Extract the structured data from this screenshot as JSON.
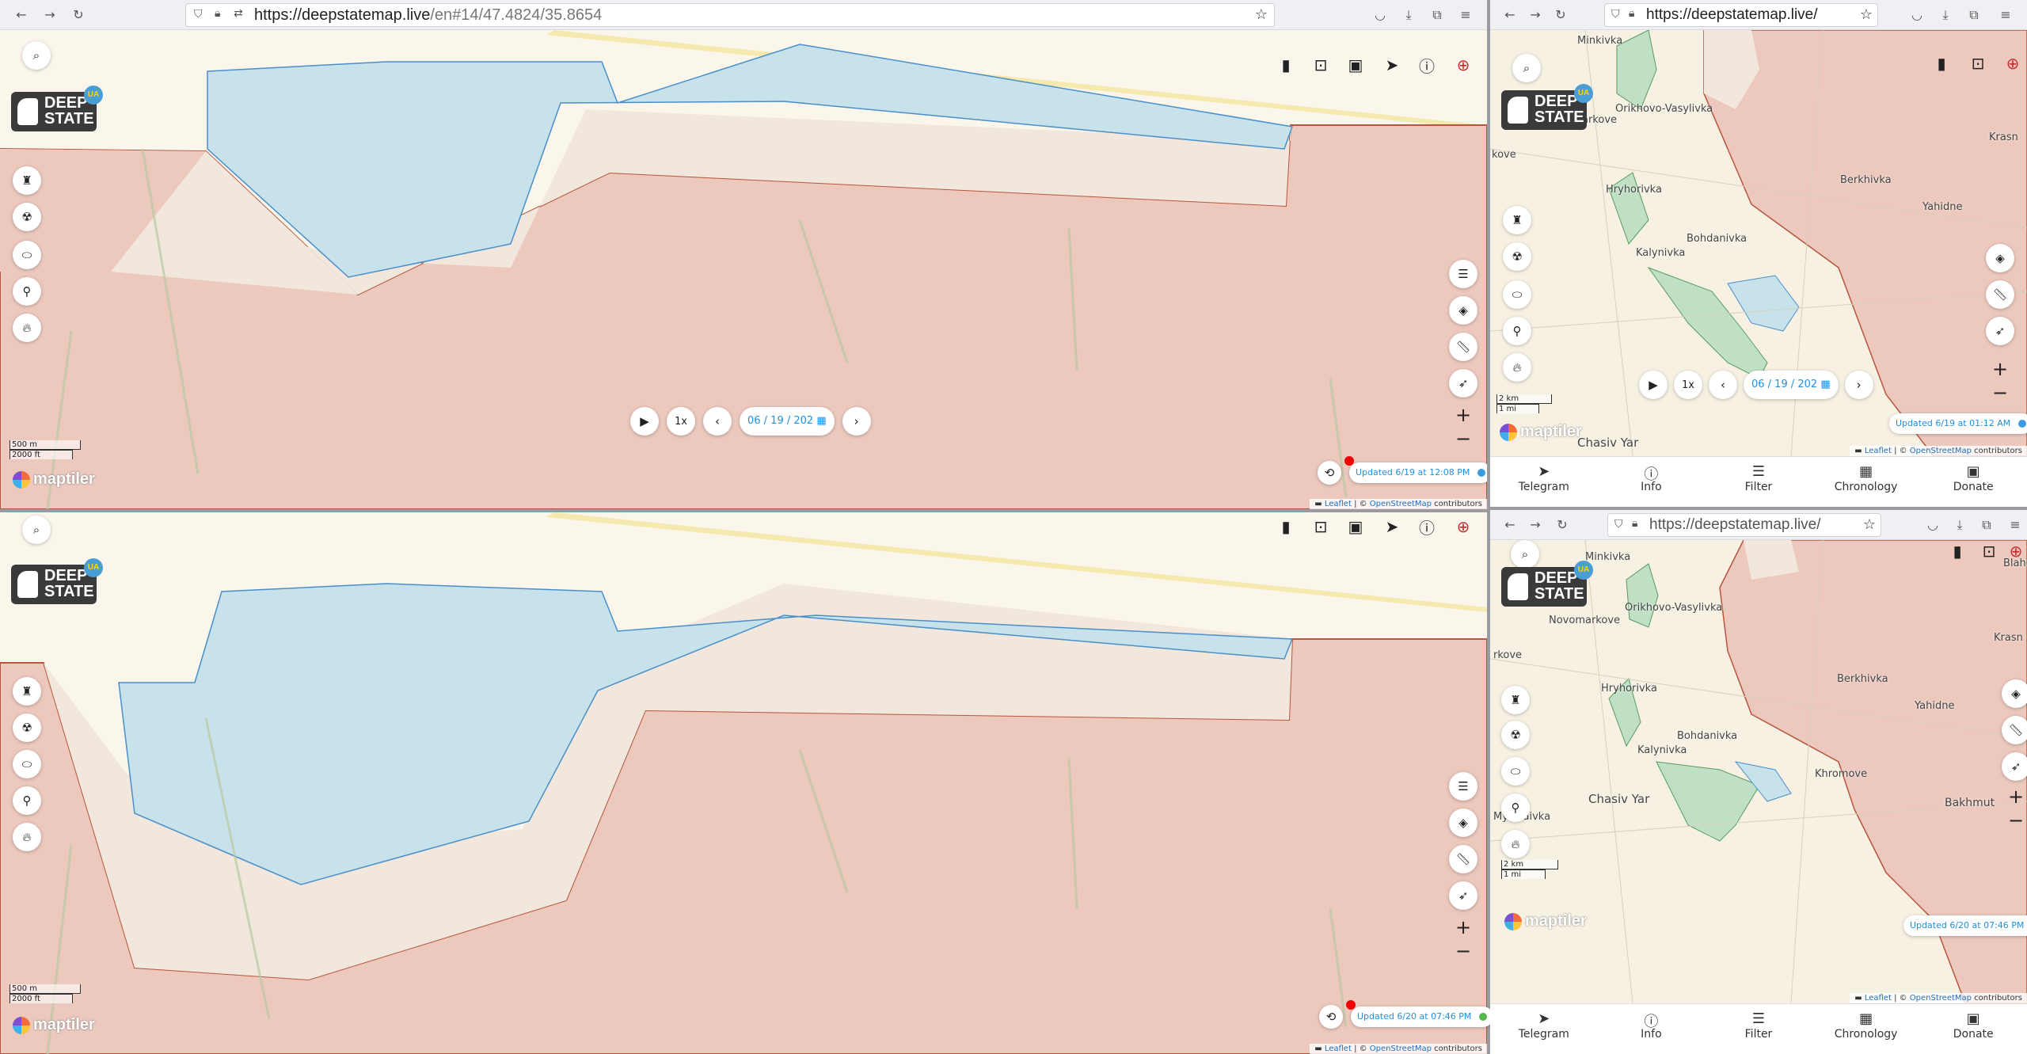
{
  "windows": {
    "top_left": {
      "url_host": "https://deepstatemap.live",
      "url_path": "/en#14/47.4824/35.8654",
      "date": "06 / 19 / 202",
      "updated": "Updated 6/19 at 12:08 PM",
      "dot_color": "#3a9be0",
      "scale_m": "500 m",
      "scale_ft": "2000 ft"
    },
    "bottom_left": {
      "date": "",
      "updated": "Updated 6/20 at 07:46 PM",
      "dot_color": "#53b94a",
      "scale_m": "500 m",
      "scale_ft": "2000 ft"
    },
    "top_right": {
      "url_host": "https://deepstatemap.live/",
      "date": "06 / 19 / 202",
      "updated": "Updated 6/19 at 01:12 AM",
      "dot_color": "#3a9be0",
      "scale_km": "2 km",
      "scale_mi": "1 mi",
      "places": [
        "Minkivka",
        "Orikhovo-Vasylivka",
        "Novomarkove",
        "kove",
        "Krasn",
        "Berkhivka",
        "Yahidne",
        "Hryhorivka",
        "Bohdanivka",
        "Kalynivka",
        "Chasiv Yar"
      ]
    },
    "bottom_right": {
      "url_host": "https://deepstatemap.live/",
      "updated": "Updated 6/20 at 07:46 PM",
      "dot_color": "#53b94a",
      "scale_km": "2 km",
      "scale_mi": "1 mi",
      "places": [
        "Minkivka",
        "Orikhovo-Vasylivka",
        "Novomarkove",
        "rkove",
        "Krasn",
        "Berkhivka",
        "Yahidne",
        "Hryhorivka",
        "Bohdanivka",
        "Kalynivka",
        "Khromove",
        "Bakhmut",
        "Chasiv Yar",
        "Mykolaivka",
        "Blaho"
      ]
    }
  },
  "common": {
    "logo_line1": "DEEP",
    "logo_line2": "STATE",
    "logo_badge": "UA",
    "speed": "1x",
    "maptiler": "maptiler",
    "attrib_leaflet": "Leaflet",
    "attrib_sep": " | © ",
    "attrib_osm": "OpenStreetMap",
    "attrib_tail": " contributors",
    "nav": [
      "Telegram",
      "Info",
      "Filter",
      "Chronology",
      "Donate"
    ]
  },
  "colors": {
    "occupied": "#ecc8bd",
    "contested": "#f1e7dc",
    "liberated_blue": "#c8e2ec",
    "ukraine_green": "#bfe0c4",
    "map_base": "#fbf6ec"
  }
}
